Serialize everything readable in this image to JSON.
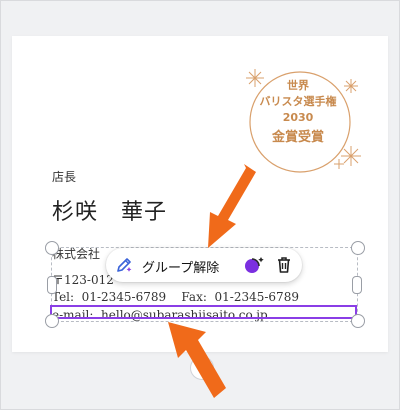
{
  "seal": {
    "line1": "世界",
    "line2": "バリスタ選手権",
    "line3": "2030",
    "line4": "金賞受賞",
    "accent_color": "#c88a4e"
  },
  "card": {
    "role": "店長",
    "name": "杉咲　華子",
    "company": "株式会社",
    "address": "〒123-012",
    "tel_line": "Tel:  01-2345-6789    Fax:  01-2345-6789",
    "email_line": "e-mail:  hello@subarashiisaito.co.jp"
  },
  "toolbar": {
    "edit_icon": "magic-pencil-icon",
    "ungroup_label": "グループ解除",
    "ai_icon": "sparkle-comment-icon",
    "delete_icon": "trash-icon"
  },
  "annotation": {
    "arrow_color": "#f06a1a",
    "selection_color": "#8a3ee6"
  }
}
